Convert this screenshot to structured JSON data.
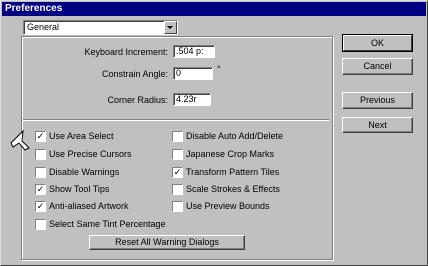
{
  "window": {
    "title": "Preferences"
  },
  "category": {
    "selected": "General"
  },
  "fields": {
    "keyboard_increment": {
      "label": "Keyboard Increment:",
      "value": ".504 p:"
    },
    "constrain_angle": {
      "label": "Constrain Angle:",
      "value": "0",
      "unit": "°"
    },
    "corner_radius": {
      "label": "Corner Radius:",
      "value": "4.23r"
    }
  },
  "options_left": [
    {
      "label": "Use Area Select",
      "checked": true
    },
    {
      "label": "Use Precise Cursors",
      "checked": false
    },
    {
      "label": "Disable Warnings",
      "checked": false
    },
    {
      "label": "Show Tool Tips",
      "checked": true
    },
    {
      "label": "Anti-aliased Artwork",
      "checked": true
    },
    {
      "label": "Select Same Tint Percentage",
      "checked": false
    }
  ],
  "options_right": [
    {
      "label": "Disable Auto Add/Delete",
      "checked": false
    },
    {
      "label": "Japanese Crop Marks",
      "checked": false
    },
    {
      "label": "Transform Pattern Tiles",
      "checked": true
    },
    {
      "label": "Scale Strokes & Effects",
      "checked": false
    },
    {
      "label": "Use Preview Bounds",
      "checked": false
    }
  ],
  "buttons": {
    "reset_warnings": "Reset All Warning Dialogs",
    "ok": "OK",
    "cancel": "Cancel",
    "previous": "Previous",
    "next": "Next"
  },
  "check_mark": "✓",
  "colors": {
    "title_bar": "#000080",
    "face": "#c0c0c0"
  }
}
